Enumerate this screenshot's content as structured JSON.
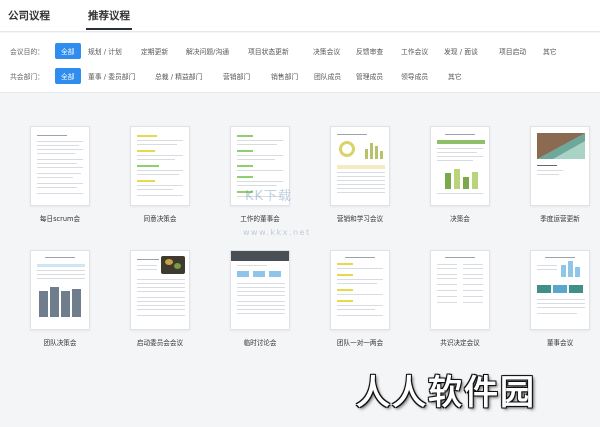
{
  "tabs": [
    {
      "label": "公司议程",
      "active": false
    },
    {
      "label": "推荐议程",
      "active": true
    }
  ],
  "filters": {
    "purpose": {
      "label": "会议目的：",
      "options": [
        "全部",
        "规划 / 计划",
        "定期更新",
        "解决问题/沟通",
        "项目状态更新",
        "决策会议",
        "反馈审查",
        "工作会议",
        "发现 / 面谈",
        "项目启动",
        "其它"
      ],
      "selected": "全部"
    },
    "department": {
      "label": "共会部门：",
      "options": [
        "全部",
        "董事 / 委员部门",
        "总裁 / 精益部门",
        "营销部门",
        "销售部门",
        "团队成员",
        "管理成员",
        "领导成员",
        "其它"
      ],
      "selected": "全部"
    }
  },
  "templates": [
    {
      "title": "每日scrum会"
    },
    {
      "title": "同意决策会"
    },
    {
      "title": "工作的董事会"
    },
    {
      "title": "营销和学习会议"
    },
    {
      "title": "决策会"
    },
    {
      "title": "季度运营更新"
    },
    {
      "title": "团队决策会"
    },
    {
      "title": "启动委员会会议"
    },
    {
      "title": "临时讨论会"
    },
    {
      "title": "团队一对一两会"
    },
    {
      "title": "共识决定会议"
    },
    {
      "title": "董事会议"
    }
  ],
  "watermark": {
    "line1": "KK下载",
    "line2": "www.kkx.net",
    "brand": "人人软件园"
  },
  "colors": {
    "accent": "#2f8df0",
    "highlight_yellow": "#e8d84a",
    "highlight_green": "#8fcf6e",
    "chart_olive": "#b9c26a",
    "chart_slate": "#6f7d8c",
    "teal": "#7fbfb0"
  }
}
